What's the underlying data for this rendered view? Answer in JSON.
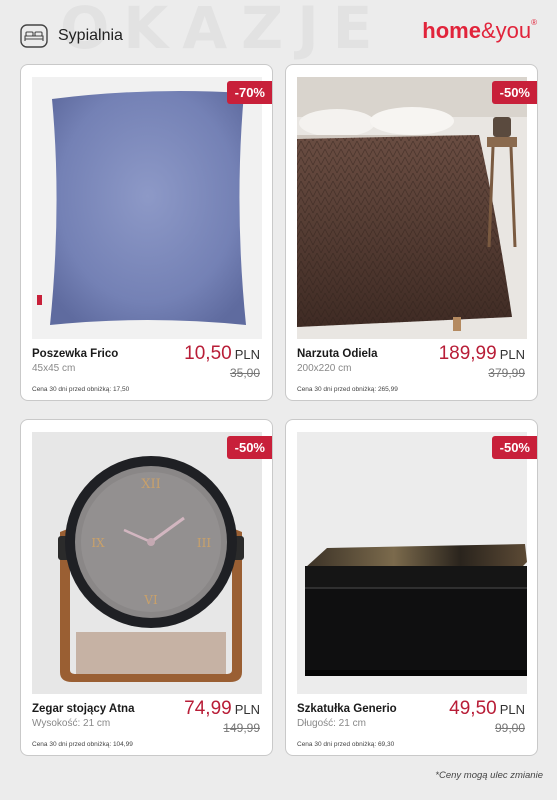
{
  "header": {
    "watermark": "OKAZJE",
    "category_icon": "bed-icon",
    "category": "Sypialnia",
    "brand_bold": "home",
    "brand_rest": "&you",
    "brand_mark": "®",
    "brand_color": "#e1243b"
  },
  "products": [
    {
      "name": "Poszewka Frico",
      "detail": "45x45 cm",
      "price": "10,50",
      "currency": "PLN",
      "old_price": "35,00",
      "discount": "-70%",
      "note": "Cena 30 dni przed obniżką: 17,50",
      "image": "pillow-image"
    },
    {
      "name": "Narzuta Odiela",
      "detail": "200x220 cm",
      "price": "189,99",
      "currency": "PLN",
      "old_price": "379,99",
      "discount": "-50%",
      "note": "Cena 30 dni przed obniżką: 265,99",
      "image": "bedspread-image"
    },
    {
      "name": "Zegar stojący Atna",
      "detail": "Wysokość: 21 cm",
      "price": "74,99",
      "currency": "PLN",
      "old_price": "149,99",
      "discount": "-50%",
      "note": "Cena 30 dni przed obniżką: 104,99",
      "image": "clock-image"
    },
    {
      "name": "Szkatułka Generio",
      "detail": "Długość: 21 cm",
      "price": "49,50",
      "currency": "PLN",
      "old_price": "99,00",
      "discount": "-50%",
      "note": "Cena 30 dni przed obniżką: 69,30",
      "image": "box-image"
    }
  ],
  "footer": {
    "disclaimer": "*Ceny mogą ulec zmianie"
  },
  "colors": {
    "accent": "#c8203a",
    "price": "#b81d37"
  }
}
